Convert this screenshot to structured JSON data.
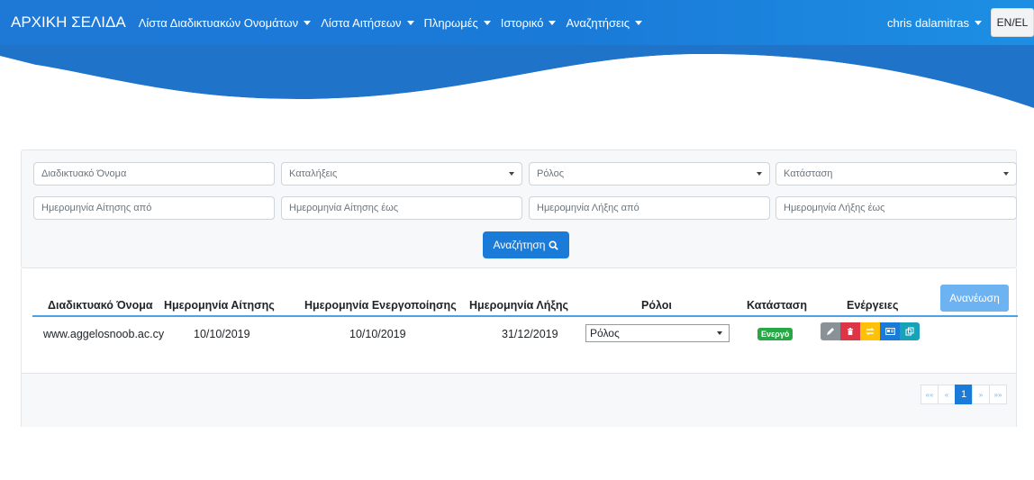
{
  "nav": {
    "brand": "ΑΡΧΙΚΗ ΣΕΛΙΔΑ",
    "menus": [
      "Λίστα Διαδικτυακών Ονομάτων",
      "Λίστα Αιτήσεων",
      "Πληρωμές",
      "Ιστορικό",
      "Αναζητήσεις"
    ],
    "user": "chris dalamitras",
    "lang": "EN/EL"
  },
  "filters": {
    "domain_name": "Διαδικτυακό Όνομα",
    "extensions": "Καταλήξεις",
    "role": "Ρόλος",
    "status": "Κατάσταση",
    "apply_from": "Ημερομηνία Αίτησης από",
    "apply_to": "Ημερομηνία Αίτησης έως",
    "expire_from": "Ημερομηνία Λήξης από",
    "expire_to": "Ημερομηνία Λήξης έως",
    "search_label": "Αναζήτηση"
  },
  "table": {
    "refresh_label": "Ανανέωση",
    "headers": [
      "Διαδικτυακό Όνομα",
      "Ημερομηνία Αίτησης",
      "Ημερομηνία Ενεργοποίησης",
      "Ημερομηνία Λήξης",
      "Ρόλοι",
      "Κατάσταση",
      "Ενέργειες"
    ],
    "rows": [
      {
        "domain": "www.aggelosnoob.ac.cy",
        "applied": "10/10/2019",
        "activated": "10/10/2019",
        "expires": "31/12/2019",
        "role": "Ρόλος",
        "status": "Ενεργό"
      }
    ]
  },
  "pagination": {
    "first": "««",
    "prev": "«",
    "current": "1",
    "next": "»",
    "last": "»»"
  },
  "colors": {
    "primary": "#1a7bd9",
    "success": "#28a745",
    "danger": "#dc3545",
    "warning": "#ffc107",
    "info": "#17a2b8",
    "secondary": "#6c757d"
  }
}
